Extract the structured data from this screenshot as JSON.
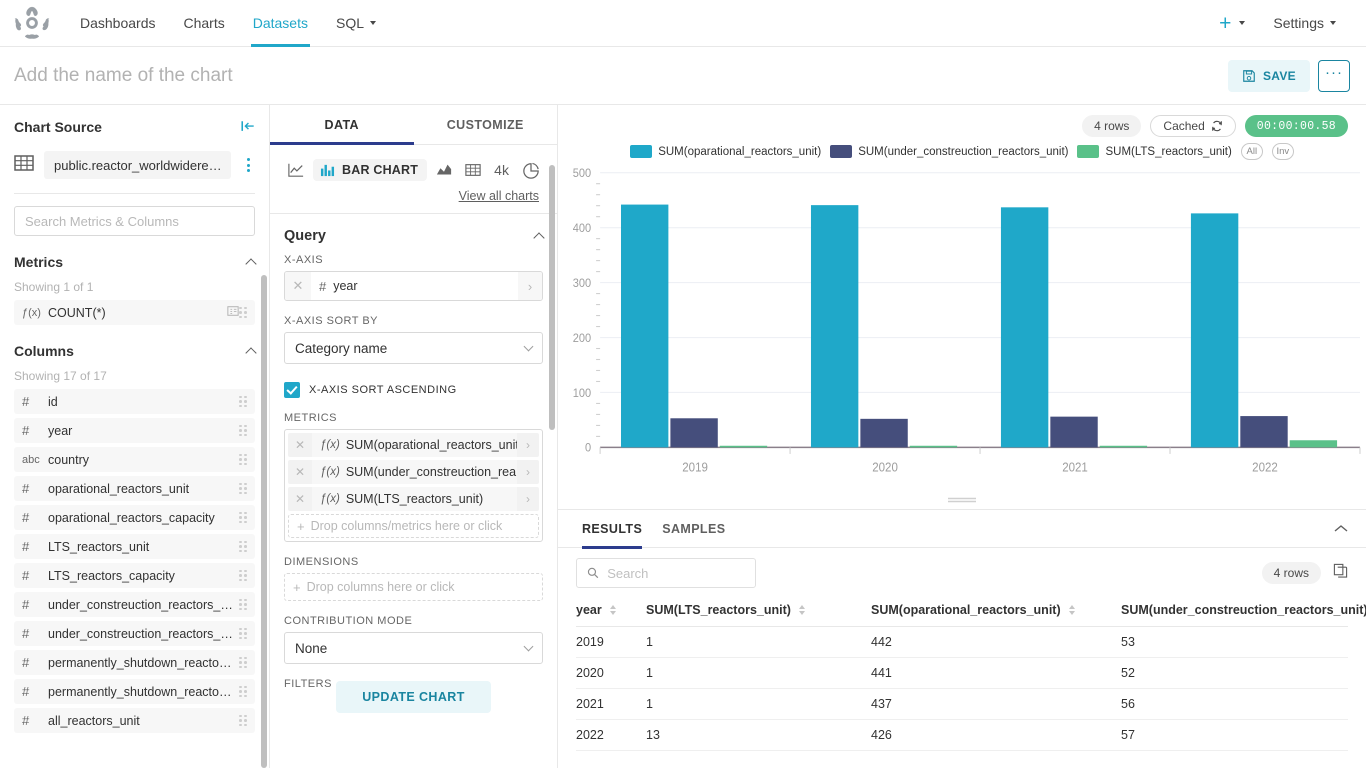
{
  "navbar": {
    "logo_icon": "superset-logo-icon",
    "items": [
      {
        "label": "Dashboards",
        "active": false,
        "caret": false
      },
      {
        "label": "Charts",
        "active": false,
        "caret": false
      },
      {
        "label": "Datasets",
        "active": true,
        "caret": false
      },
      {
        "label": "SQL",
        "active": false,
        "caret": true
      }
    ],
    "plus_label": "+",
    "settings_label": "Settings"
  },
  "chart_header": {
    "title_placeholder": "Add the name of the chart",
    "save_label": "SAVE",
    "save_icon": "save-disk-icon",
    "more_label": "···"
  },
  "datasource": {
    "panel_title": "Chart Source",
    "collapse_icon": "collapse-left-icon",
    "dataset_name": "public.reactor_worldwidere…",
    "search_placeholder": "Search Metrics & Columns",
    "metrics_section": {
      "title": "Metrics",
      "showing": "Showing 1 of 1",
      "items": [
        {
          "type": "ƒ(x)",
          "name": "COUNT(*)",
          "certified": true
        }
      ]
    },
    "columns_section": {
      "title": "Columns",
      "showing": "Showing 17 of 17",
      "items": [
        {
          "type": "#",
          "name": "id"
        },
        {
          "type": "#",
          "name": "year"
        },
        {
          "type": "abc",
          "name": "country"
        },
        {
          "type": "#",
          "name": "oparational_reactors_unit"
        },
        {
          "type": "#",
          "name": "oparational_reactors_capacity"
        },
        {
          "type": "#",
          "name": "LTS_reactors_unit"
        },
        {
          "type": "#",
          "name": "LTS_reactors_capacity"
        },
        {
          "type": "#",
          "name": "under_constreuction_reactors_…"
        },
        {
          "type": "#",
          "name": "under_constreuction_reactors_…"
        },
        {
          "type": "#",
          "name": "permanently_shutdown_reacto…"
        },
        {
          "type": "#",
          "name": "permanently_shutdown_reacto…"
        },
        {
          "type": "#",
          "name": "all_reactors_unit"
        }
      ]
    }
  },
  "control_panel": {
    "tabs": [
      {
        "label": "DATA",
        "active": true
      },
      {
        "label": "CUSTOMIZE",
        "active": false
      }
    ],
    "viz_types": [
      {
        "icon": "line-chart-icon",
        "label": "",
        "selected": false
      },
      {
        "icon": "bar-chart-icon",
        "label": "BAR CHART",
        "selected": true
      },
      {
        "icon": "area-chart-icon",
        "label": "",
        "selected": false
      },
      {
        "icon": "table-icon",
        "label": "",
        "selected": false
      },
      {
        "icon": "big-number-icon",
        "label": "4k",
        "selected": false
      },
      {
        "icon": "pie-chart-icon",
        "label": "",
        "selected": false
      }
    ],
    "view_all_label": "View all charts",
    "query_section_title": "Query",
    "x_axis_label": "X-AXIS",
    "x_axis_value": {
      "type": "#",
      "name": "year"
    },
    "x_axis_sort_by_label": "X-AXIS SORT BY",
    "x_axis_sort_by_value": "Category name",
    "x_axis_sort_ascending_label": "X-AXIS SORT ASCENDING",
    "x_axis_sort_ascending_checked": true,
    "metrics_label": "METRICS",
    "metrics": [
      {
        "type": "ƒ(x)",
        "name": "SUM(oparational_reactors_unit)"
      },
      {
        "type": "ƒ(x)",
        "name": "SUM(under_constreuction_rea…"
      },
      {
        "type": "ƒ(x)",
        "name": "SUM(LTS_reactors_unit)"
      }
    ],
    "metrics_dropzone": "Drop columns/metrics here or click",
    "dimensions_label": "DIMENSIONS",
    "dimensions_dropzone": "Drop columns here or click",
    "contribution_mode_label": "CONTRIBUTION MODE",
    "contribution_mode_value": "None",
    "filters_label": "FILTERS",
    "update_chart_label": "UPDATE CHART"
  },
  "chart_pane": {
    "rows_badge": "4 rows",
    "cached_badge": "Cached",
    "cached_icon": "refresh-icon",
    "timer_badge": "00:00:00.58",
    "legend_all": "All",
    "legend_inv": "Inv"
  },
  "results": {
    "tabs": [
      {
        "label": "RESULTS",
        "active": true
      },
      {
        "label": "SAMPLES",
        "active": false
      }
    ],
    "collapse_icon": "chevron-up-icon",
    "search_placeholder": "Search",
    "rows_badge": "4 rows",
    "copy_icon": "copy-icon",
    "columns": [
      "year",
      "SUM(LTS_reactors_unit)",
      "SUM(oparational_reactors_unit)",
      "SUM(under_constreuction_reactors_unit)"
    ],
    "rows": [
      [
        "2019",
        "1",
        "442",
        "53"
      ],
      [
        "2020",
        "1",
        "441",
        "52"
      ],
      [
        "2021",
        "1",
        "437",
        "56"
      ],
      [
        "2022",
        "13",
        "426",
        "57"
      ]
    ]
  },
  "chart_data": {
    "type": "bar",
    "title": "",
    "xlabel": "",
    "ylabel": "",
    "categories": [
      "2019",
      "2020",
      "2021",
      "2022"
    ],
    "series": [
      {
        "name": "SUM(oparational_reactors_unit)",
        "color": "#1FA8C9",
        "values": [
          442,
          441,
          437,
          426
        ]
      },
      {
        "name": "SUM(under_constreuction_reactors_unit)",
        "color": "#454E7C",
        "values": [
          53,
          52,
          56,
          57
        ]
      },
      {
        "name": "SUM(LTS_reactors_unit)",
        "color": "#5AC189",
        "values": [
          1,
          1,
          1,
          13
        ]
      }
    ],
    "ylim": [
      0,
      500
    ],
    "yticks": [
      0,
      100,
      200,
      300,
      400,
      500
    ],
    "grid": true,
    "legend_position": "top"
  },
  "colors": {
    "accent": "#20a7c9",
    "series1": "#1FA8C9",
    "series2": "#454E7C",
    "series3": "#5AC189",
    "tab_indigo": "#2c3c8d",
    "success": "#5ac189"
  }
}
